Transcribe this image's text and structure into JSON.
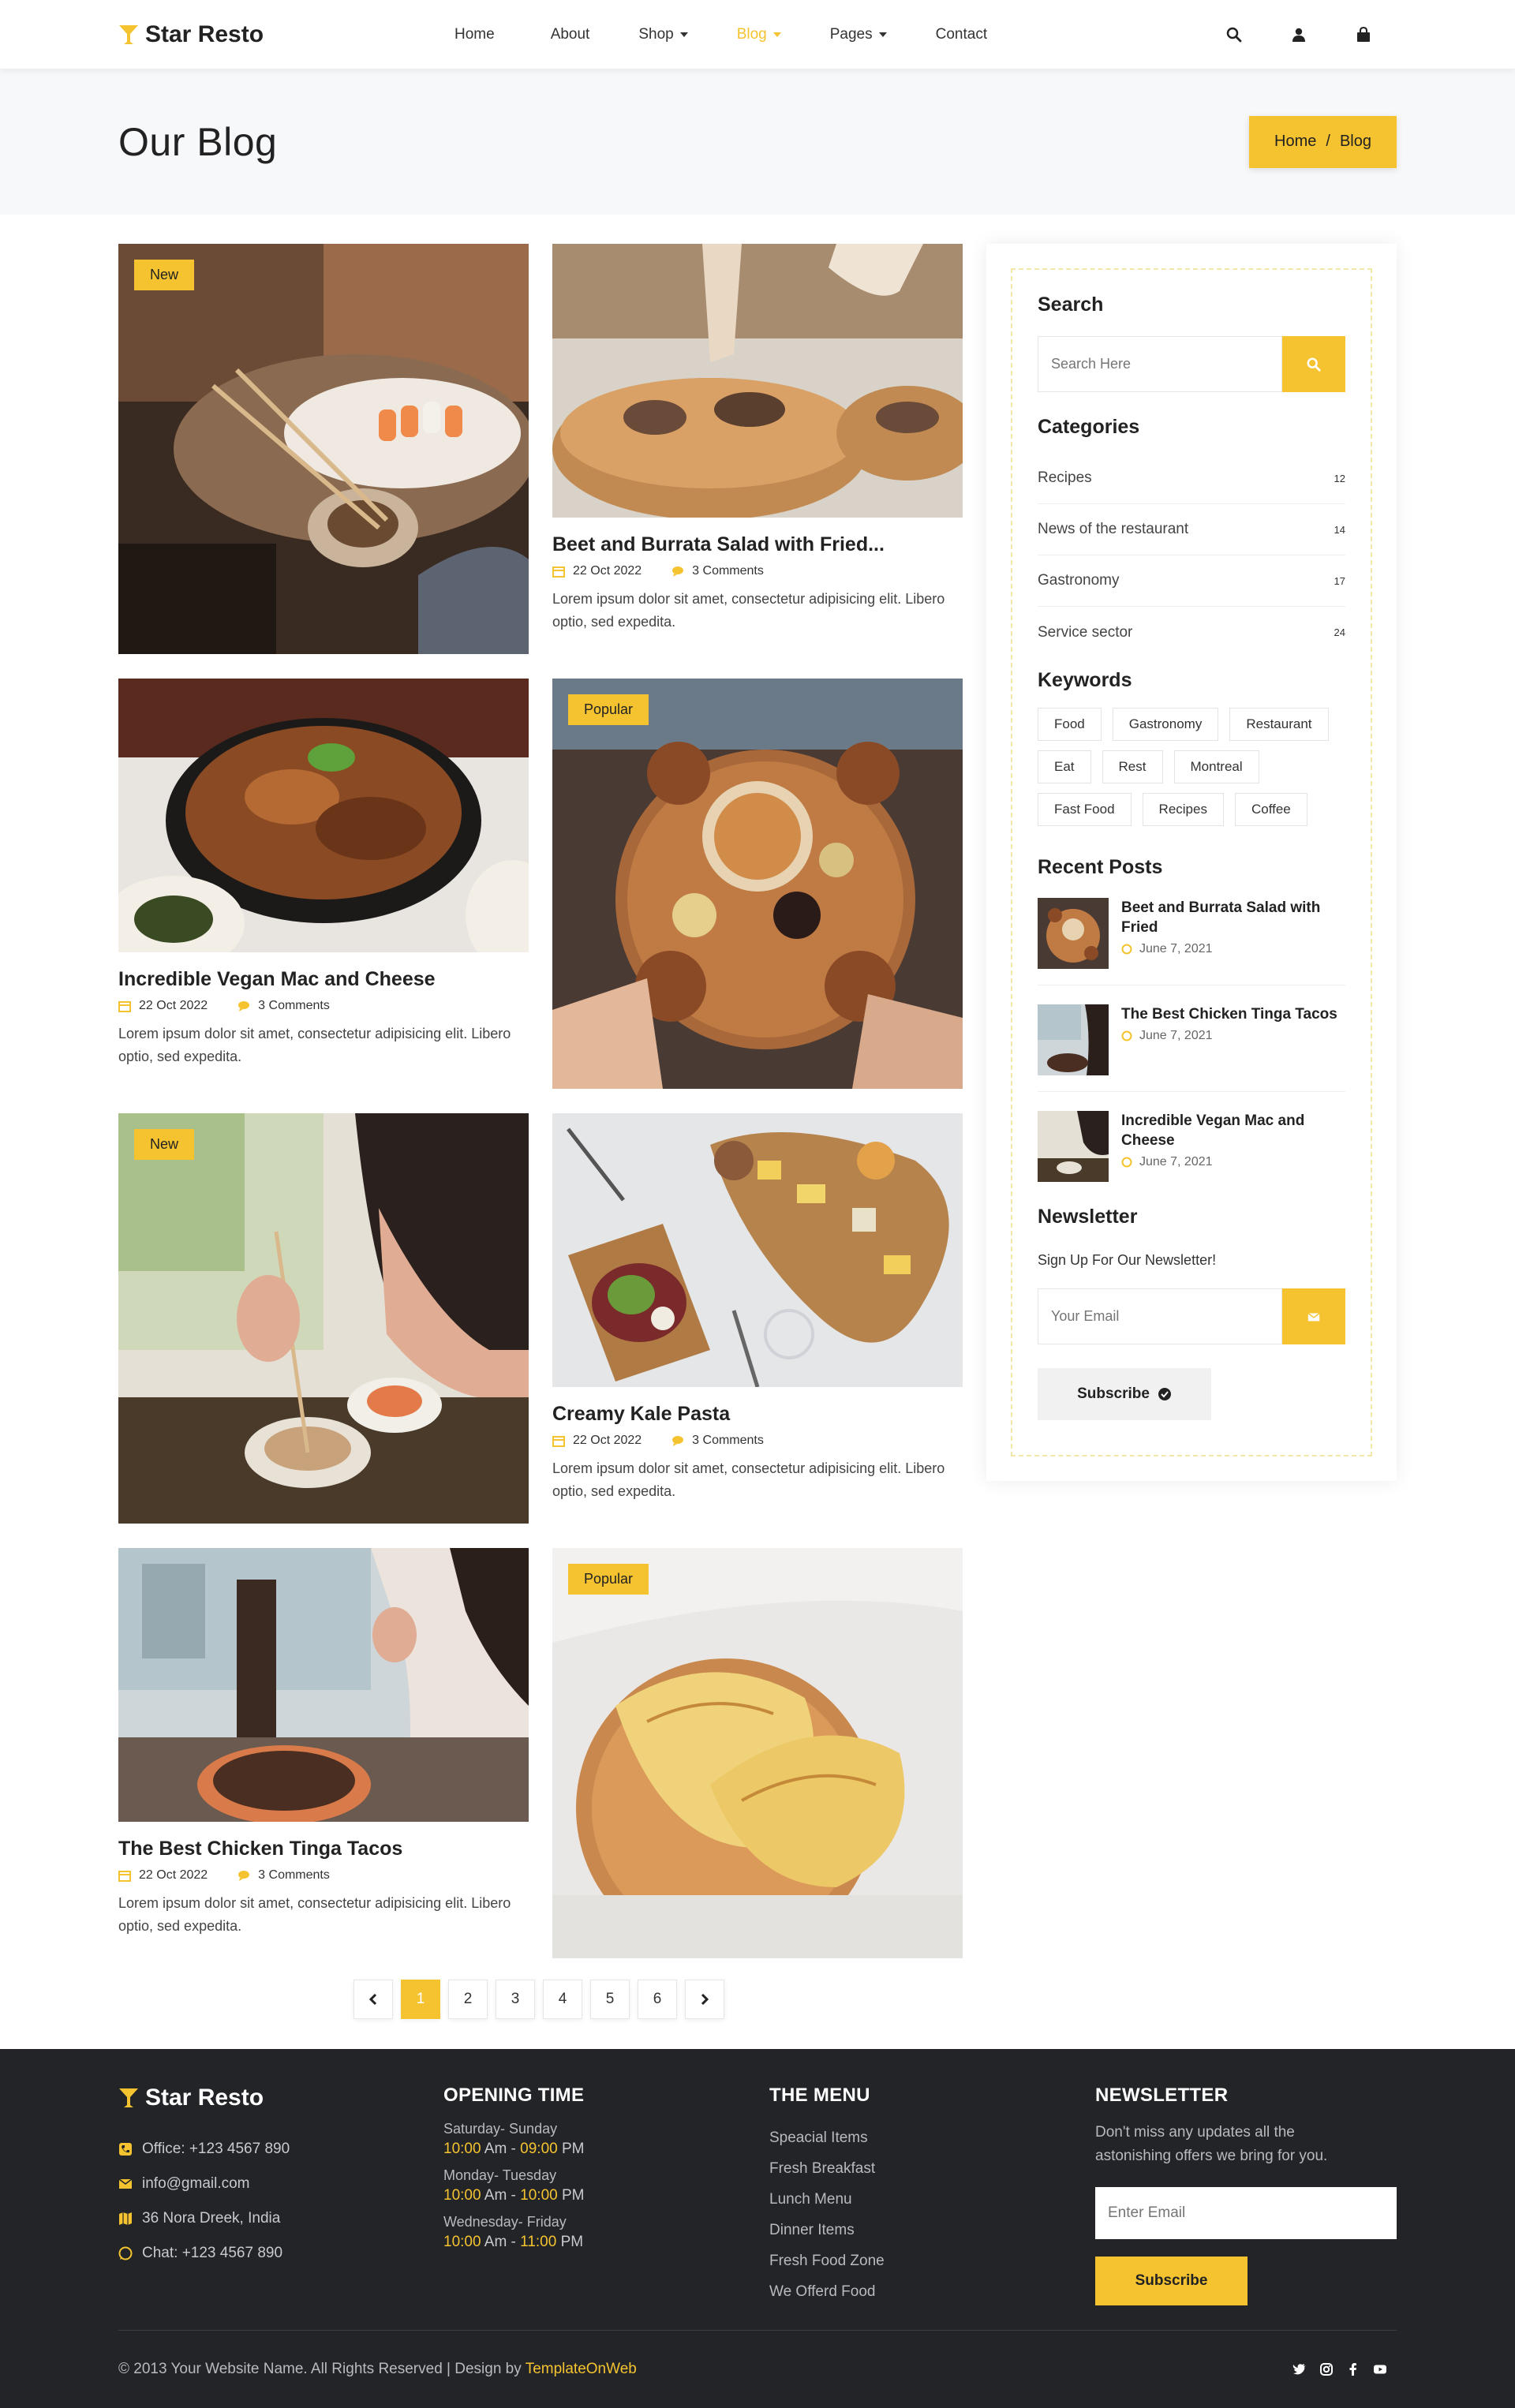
{
  "brand": {
    "name": "Star Resto"
  },
  "nav": {
    "items": [
      {
        "label": "Home"
      },
      {
        "label": "About"
      },
      {
        "label": "Shop"
      },
      {
        "label": "Blog"
      },
      {
        "label": "Pages"
      },
      {
        "label": "Contact"
      }
    ],
    "active": "Blog",
    "icons": [
      "search-icon",
      "user-icon",
      "shopping-bag-icon"
    ]
  },
  "page_title": {
    "title": "Our Blog",
    "breadcrumb": [
      "Home",
      "/",
      "Blog"
    ]
  },
  "posts": [
    {
      "badge": "New",
      "title": "",
      "date": "",
      "comments": "",
      "excerpt": ""
    },
    {
      "badge": "",
      "title": "Beet and Burrata Salad with Fried...",
      "date": "22 Oct 2022",
      "comments": "3 Comments",
      "excerpt": "Lorem ipsum dolor sit amet, consectetur adipisicing elit. Libero optio, sed expedita."
    },
    {
      "badge": "",
      "title": "Incredible Vegan Mac and Cheese",
      "date": "22 Oct 2022",
      "comments": "3 Comments",
      "excerpt": "Lorem ipsum dolor sit amet, consectetur adipisicing elit. Libero optio, sed expedita."
    },
    {
      "badge": "Popular",
      "title": "",
      "date": "",
      "comments": "",
      "excerpt": ""
    },
    {
      "badge": "New",
      "title": "",
      "date": "",
      "comments": "",
      "excerpt": ""
    },
    {
      "badge": "",
      "title": "Creamy Kale Pasta",
      "date": "22 Oct 2022",
      "comments": "3 Comments",
      "excerpt": "Lorem ipsum dolor sit amet, consectetur adipisicing elit. Libero optio, sed expedita."
    },
    {
      "badge": "",
      "title": "The Best Chicken Tinga Tacos",
      "date": "22 Oct 2022",
      "comments": "3 Comments",
      "excerpt": "Lorem ipsum dolor sit amet, consectetur adipisicing elit. Libero optio, sed expedita."
    },
    {
      "badge": "Popular",
      "title": "",
      "date": "",
      "comments": "",
      "excerpt": ""
    }
  ],
  "sidebar": {
    "search": {
      "heading": "Search",
      "placeholder": "Search Here"
    },
    "categories": {
      "heading": "Categories",
      "items": [
        {
          "label": "Recipes",
          "count": "12"
        },
        {
          "label": "News of the restaurant",
          "count": "14"
        },
        {
          "label": "Gastronomy",
          "count": "17"
        },
        {
          "label": "Service sector",
          "count": "24"
        }
      ]
    },
    "keywords": {
      "heading": "Keywords",
      "tags": [
        "Food",
        "Gastronomy",
        "Restaurant",
        "Eat",
        "Rest",
        "Montreal",
        "Fast Food",
        "Recipes",
        "Coffee"
      ]
    },
    "recent": {
      "heading": "Recent Posts",
      "items": [
        {
          "title": "Beet and Burrata Salad with Fried",
          "date": "June 7, 2021"
        },
        {
          "title": "The Best Chicken Tinga Tacos",
          "date": "June 7, 2021"
        },
        {
          "title": "Incredible Vegan Mac and Cheese",
          "date": "June 7, 2021"
        }
      ]
    },
    "newsletter": {
      "heading": "Newsletter",
      "text": "Sign Up For Our Newsletter!",
      "placeholder": "Your Email",
      "button": "Subscribe"
    }
  },
  "pagination": {
    "pages": [
      "1",
      "2",
      "3",
      "4",
      "5",
      "6"
    ],
    "current": "1"
  },
  "footer": {
    "brand": "Star Resto",
    "contact": [
      {
        "icon": "phone-icon",
        "text": "Office: +123 4567 890"
      },
      {
        "icon": "envelope-icon",
        "text": "info@gmail.com"
      },
      {
        "icon": "map-icon",
        "text": "36 Nora Dreek, India"
      },
      {
        "icon": "whatsapp-icon",
        "text": "Chat: +123 4567 890"
      }
    ],
    "opening": {
      "heading": "OPENING TIME",
      "rows": [
        {
          "days": "Saturday- Sunday",
          "open": "10:00",
          "open_suffix": " Am - ",
          "close": "09:00",
          "close_suffix": " PM"
        },
        {
          "days": "Monday- Tuesday",
          "open": "10:00",
          "open_suffix": " Am - ",
          "close": "10:00",
          "close_suffix": " PM"
        },
        {
          "days": "Wednesday- Friday",
          "open": "10:00",
          "open_suffix": " Am - ",
          "close": "11:00",
          "close_suffix": " PM"
        }
      ]
    },
    "menu": {
      "heading": "THE MENU",
      "items": [
        "Speacial Items",
        "Fresh Breakfast",
        "Lunch Menu",
        "Dinner Items",
        "Fresh Food Zone",
        "We Offerd Food"
      ]
    },
    "newsletter": {
      "heading": "NEWSLETTER",
      "text": "Don't miss any updates all the astonishing offers we bring for you.",
      "placeholder": "Enter Email",
      "button": "Subscribe"
    },
    "copyright": "© 2013 Your Website Name. All Rights Reserved | Design by",
    "copyright_link": "TemplateOnWeb",
    "social": [
      "twitter-icon",
      "instagram-icon",
      "facebook-icon",
      "youtube-icon"
    ]
  },
  "colors": {
    "accent": "#f5c330",
    "footer_bg": "#222428",
    "title_bg": "#f7f8fa"
  }
}
